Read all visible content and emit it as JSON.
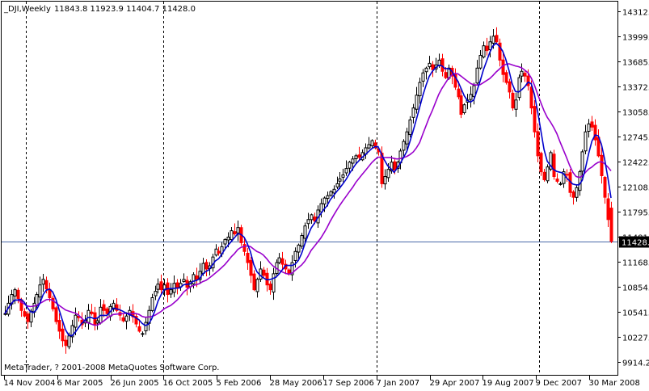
{
  "header": {
    "symbol": "_DJI,Weekly",
    "ohlc": "11843.8 11923.9 11404.7 11428.0"
  },
  "footer": {
    "copyright": "MetaTrader, ? 2001-2008 MetaQuotes Software Corp."
  },
  "colors": {
    "background": "#ffffff",
    "frame": "#000000",
    "bull_candle": "#000000",
    "bear_candle": "#ff0000",
    "fast_ma": "#0000cc",
    "slow_ma": "#9900cc",
    "last_price_line": "#4a6aa8",
    "last_price_box": "#000000",
    "last_price_text": "#ffffff"
  },
  "chart_data": {
    "type": "candlestick",
    "symbol": "_DJI",
    "timeframe": "Weekly",
    "ylim": [
      9914.2,
      14312.5
    ],
    "y_ticks": [
      "14312.5",
      "13999.0",
      "13685.5",
      "13372.0",
      "13058.5",
      "12745.0",
      "12422.0",
      "12108.5",
      "11795.0",
      "11481.5",
      "11168.0",
      "10854.5",
      "10541.0",
      "10227.5",
      "9914.2"
    ],
    "x_ticks": [
      "14 Nov 2004",
      "6 Mar 2005",
      "26 Jun 2005",
      "16 Oct 2005",
      "5 Feb 2006",
      "28 May 2006",
      "17 Sep 2006",
      "7 Jan 2007",
      "29 Apr 2007",
      "19 Aug 2007",
      "9 Dec 2007",
      "30 Mar 2008"
    ],
    "separator_ticks": [
      "14 Nov 2004",
      "16 Oct 2005",
      "7 Jan 2007",
      "9 Dec 2007"
    ],
    "last_price": "11428.0",
    "grid": false,
    "close_series": [
      10520,
      10650,
      10760,
      10820,
      10710,
      10560,
      10490,
      10420,
      10550,
      10650,
      10760,
      10880,
      10950,
      10830,
      10720,
      10580,
      10420,
      10300,
      10180,
      10120,
      10240,
      10370,
      10500,
      10470,
      10380,
      10440,
      10560,
      10520,
      10380,
      10430,
      10600,
      10560,
      10520,
      10610,
      10650,
      10560,
      10500,
      10430,
      10490,
      10560,
      10480,
      10390,
      10300,
      10270,
      10410,
      10560,
      10720,
      10800,
      10890,
      10820,
      10880,
      10760,
      10820,
      10900,
      10840,
      10900,
      10950,
      10850,
      10920,
      11010,
      10950,
      11050,
      11150,
      11080,
      11120,
      11230,
      11330,
      11280,
      11360,
      11450,
      11480,
      11560,
      11520,
      11600,
      11410,
      11300,
      11160,
      11000,
      10820,
      10950,
      11080,
      11000,
      10880,
      10820,
      11020,
      11160,
      11220,
      11140,
      11080,
      11020,
      11160,
      11300,
      11380,
      11500,
      11620,
      11700,
      11760,
      11680,
      11820,
      11900,
      11970,
      12000,
      12050,
      12080,
      12150,
      12210,
      12260,
      12340,
      12420,
      12460,
      12500,
      12480,
      12540,
      12600,
      12640,
      12690,
      12600,
      12550,
      12150,
      12240,
      12330,
      12420,
      12320,
      12420,
      12560,
      12680,
      12800,
      12950,
      13100,
      13260,
      13420,
      13540,
      13600,
      13660,
      13580,
      13640,
      13700,
      13560,
      13480,
      13600,
      13500,
      13360,
      13240,
      13020,
      13140,
      13200,
      13270,
      13380,
      13600,
      13760,
      13880,
      13820,
      13930,
      14000,
      13930,
      13700,
      13520,
      13420,
      13300,
      13100,
      13200,
      13480,
      13560,
      13500,
      13380,
      13100,
      12800,
      12500,
      12300,
      12200,
      12360,
      12540,
      12240,
      12180,
      12150,
      12300,
      12260,
      12040,
      11980,
      12100,
      12300,
      12550,
      12800,
      12900,
      12860,
      12700,
      12500,
      12250,
      11980,
      11700,
      11428
    ]
  }
}
